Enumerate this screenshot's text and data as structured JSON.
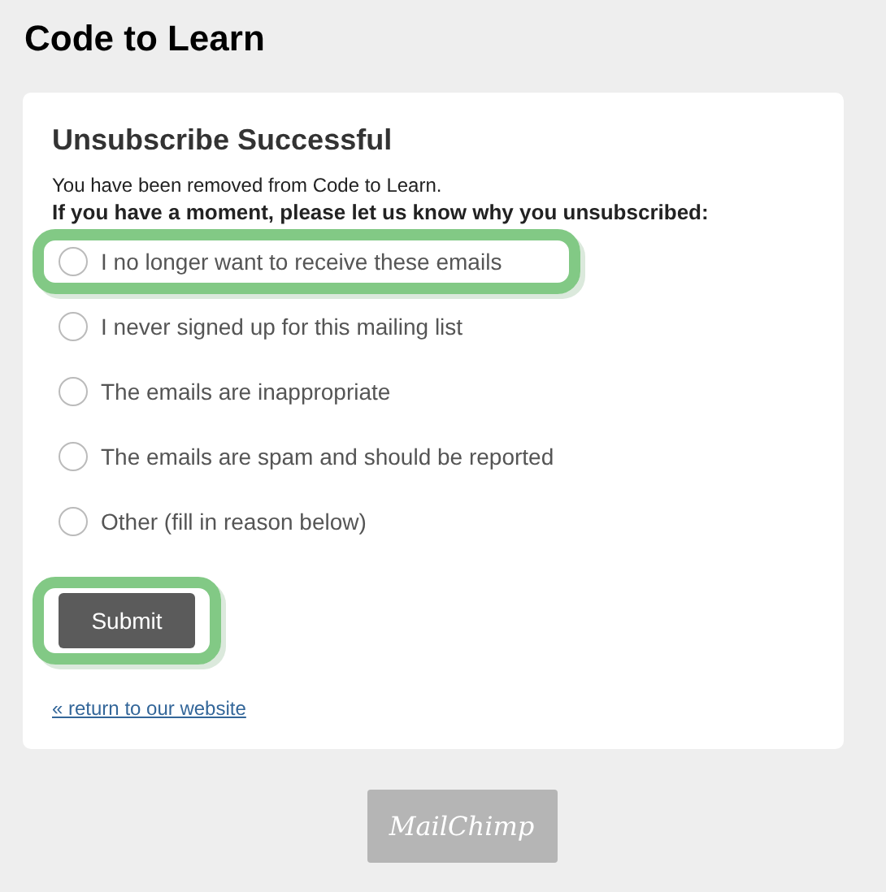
{
  "page_title": "Code to Learn",
  "card": {
    "heading": "Unsubscribe Successful",
    "message": "You have been removed from Code to Learn.",
    "question": "If you have a moment, please let us know why you unsubscribed:",
    "options": [
      {
        "label": "I no longer want to receive these emails",
        "selected": false,
        "highlighted": true
      },
      {
        "label": "I never signed up for this mailing list",
        "selected": false,
        "highlighted": false
      },
      {
        "label": "The emails are inappropriate",
        "selected": false,
        "highlighted": false
      },
      {
        "label": "The emails are spam and should be reported",
        "selected": false,
        "highlighted": false
      },
      {
        "label": "Other (fill in reason below)",
        "selected": false,
        "highlighted": false
      }
    ],
    "submit": {
      "label": "Submit",
      "highlighted": true
    },
    "return_link": "« return to our website"
  },
  "footer_logo": "MailChimp"
}
